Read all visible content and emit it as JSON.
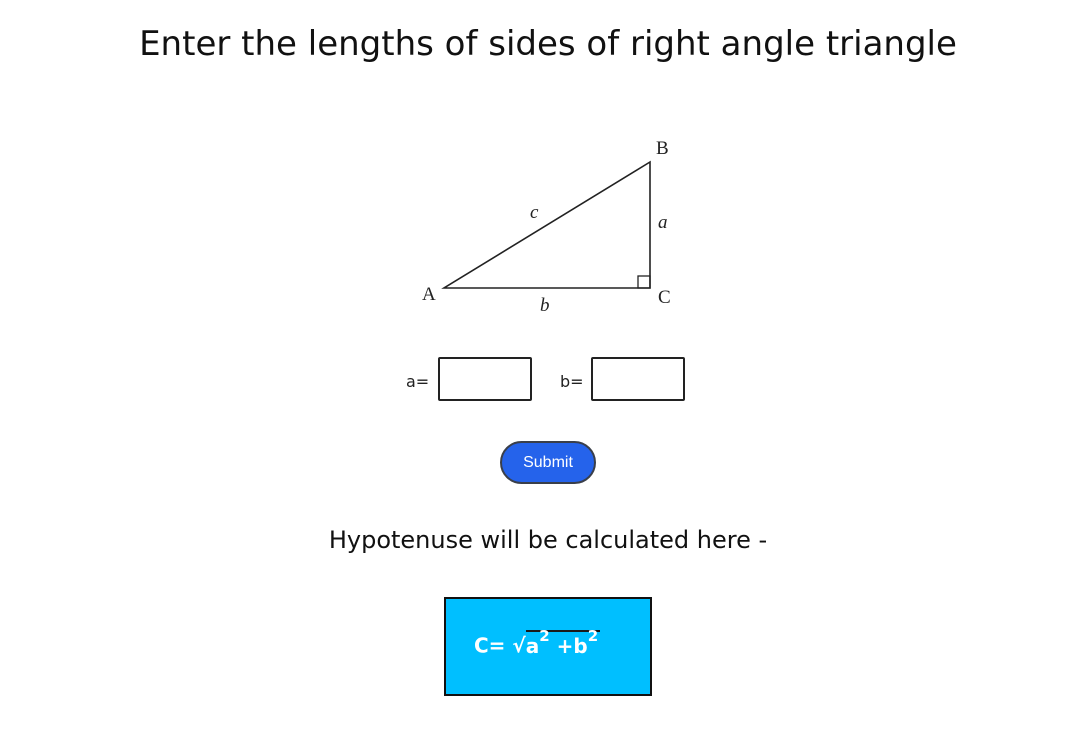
{
  "heading": "Enter the lengths of sides of right angle triangle",
  "triangle": {
    "vertex_a": "A",
    "vertex_b": "B",
    "vertex_c": "C",
    "side_a": "a",
    "side_b": "b",
    "side_c": "c"
  },
  "inputs": {
    "a_label": "a=",
    "a_value": "",
    "b_label": "b=",
    "b_value": ""
  },
  "submit_label": "Submit",
  "result_caption": "Hypotenuse will be calculated here -",
  "formula": {
    "prefix": "C=",
    "radical": "√",
    "term_a": "a",
    "exp_a": "2",
    "plus": "+b",
    "exp_b": "2"
  },
  "colors": {
    "submit_bg": "#2563eb",
    "result_bg": "#00bfff"
  }
}
